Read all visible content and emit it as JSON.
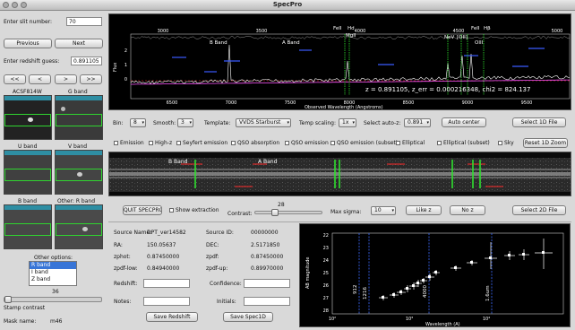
{
  "window": {
    "title": "SpecPro"
  },
  "left": {
    "slit_label": "Enter slit number:",
    "slit_value": "70",
    "prev": "Previous",
    "next": "Next",
    "redshift_label": "Enter redshift guess:",
    "redshift_value": "0.891105",
    "arrows": [
      "<<",
      "<",
      ">",
      ">>"
    ],
    "thumbs": [
      "ACSF814W",
      "G band",
      "U band",
      "V band",
      "B band",
      "Other: R band"
    ],
    "other_options": "Other options:",
    "options": [
      "R band",
      "I band",
      "Z band"
    ],
    "stamp_value": "36",
    "stamp_contrast": "Stamp contrast",
    "mask_label": "Mask name:",
    "mask_value": "m46"
  },
  "spectrum1d": {
    "xlabel": "Observed Wavelength (Angstroms)",
    "ylabel": "Flux",
    "xticks": [
      "6500",
      "7000",
      "7500",
      "8000",
      "8500",
      "9000",
      "9500"
    ],
    "top_ticks": [
      "3000",
      "3500",
      "4000",
      "4500",
      "5000"
    ],
    "lines_top": [
      "B Band",
      "A Band",
      "FeII",
      "Hd",
      "MgII",
      "NeV",
      "[OII]",
      "FeII",
      "Hβ",
      "OIII"
    ],
    "annotation": "z = 0.891105, z_err = 0.000216348, chi2 = 824.137",
    "yticks": [
      "2",
      "1",
      "0"
    ]
  },
  "controls1": {
    "bin_label": "Bin:",
    "bin_value": "8",
    "smooth_label": "Smooth:",
    "smooth_value": "3",
    "template_label": "Template:",
    "template_value": "VVDS Starburst",
    "temp_scaling_label": "Temp scaling:",
    "temp_scaling_value": "1x",
    "autoz_label": "Select auto-z:",
    "autoz_value": "0.891",
    "auto_center": "Auto center",
    "select_1d": "Select 1D File"
  },
  "checkboxes": [
    "Emission",
    "High-z",
    "Seyfert emission",
    "QSO absorption",
    "QSO emission",
    "QSO emission (subset)",
    "Elliptical",
    "Elliptical (subset)",
    "Sky"
  ],
  "reset_zoom": "Reset 1D Zoom",
  "spectrum2d": {
    "labels": [
      "B Band",
      "A Band"
    ]
  },
  "controls2": {
    "quit": "QUIT SPECPRO",
    "show_extraction": "Show extraction",
    "contrast_label": "Contrast:",
    "contrast_value": "28",
    "contrast_fraction": 0.28,
    "maxsigma_label": "Max sigma:",
    "maxsigma_value": "10",
    "like_z": "Like z",
    "no_z": "No z",
    "select_2d": "Select 2D File"
  },
  "info": {
    "source_name_label": "Source Name:",
    "source_name_value": "DPT_ver14582",
    "source_id_label": "Source ID:",
    "source_id_value": "00000000",
    "ra_label": "RA:",
    "ra_value": "150.05637",
    "dec_label": "DEC:",
    "dec_value": "2.5171850",
    "zphot_label": "zphot:",
    "zphot_value": "0.87450000",
    "zpdf_label": "zpdf:",
    "zpdf_value": "0.87450000",
    "zpdf_low_label": "zpdf-low:",
    "zpdf_low_value": "0.84940000",
    "zpdf_up_label": "zpdf-up:",
    "zpdf_up_value": "0.89970000",
    "redshift_label": "Redshift:",
    "confidence_label": "Confidence:",
    "notes_label": "Notes:",
    "initials_label": "Initials:",
    "save_redshift": "Save Redshift",
    "save_spec1d": "Save Spec1D"
  },
  "sed": {
    "ylabel": "AB magnitude",
    "xlabel": "Wavelength (A)",
    "yticks": [
      "22",
      "23",
      "24",
      "25",
      "26",
      "27",
      "28"
    ],
    "xticks": [
      "10²",
      "10³",
      "10⁴"
    ],
    "vlabels": [
      "912",
      "1216",
      "4000",
      "1.6um"
    ]
  }
}
